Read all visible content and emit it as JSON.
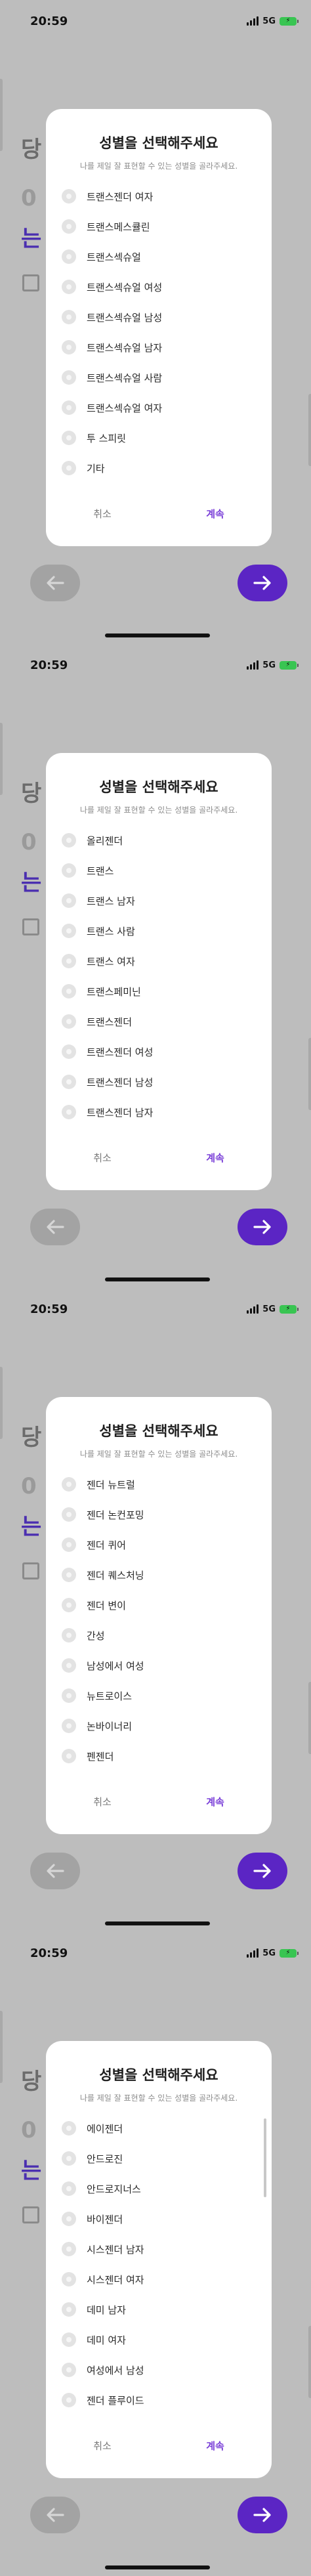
{
  "status": {
    "time": "20:59",
    "network": "5G"
  },
  "background": {
    "char1": "당",
    "char2": "0",
    "char3": "는"
  },
  "modal": {
    "title": "성별을 선택해주세요",
    "subtitle": "나를 제일 잘 표현할 수 있는 성별을 골라주세요.",
    "cancel": "취소",
    "continue": "계속"
  },
  "screens": [
    {
      "options": [
        "트랜스젠더 여자",
        "트랜스메스큘린",
        "트랜스섹슈얼",
        "트랜스섹슈얼 여성",
        "트랜스섹슈얼 남성",
        "트랜스섹슈얼 남자",
        "트랜스섹슈얼 사람",
        "트랜스섹슈얼 여자",
        "투 스피릿",
        "기타"
      ]
    },
    {
      "options": [
        "올리젠더",
        "트랜스",
        "트랜스 남자",
        "트랜스 사람",
        "트랜스 여자",
        "트랜스페미닌",
        "트랜스젠더",
        "트랜스젠더 여성",
        "트랜스젠더 남성",
        "트랜스젠더 남자"
      ]
    },
    {
      "options": [
        "젠더 뉴트럴",
        "젠더 논컨포밍",
        "젠더 퀴어",
        "젠더 퀘스처닝",
        "젠더 변이",
        "간성",
        "남성에서 여성",
        "뉴트로이스",
        "논바이너리",
        "펜젠더"
      ]
    },
    {
      "options": [
        "에이젠더",
        "안드로진",
        "안드로지너스",
        "바이젠더",
        "시스젠더 남자",
        "시스젠더 여자",
        "데미 남자",
        "데미 여자",
        "여성에서 남성",
        "젠더 플루이드"
      ]
    }
  ]
}
